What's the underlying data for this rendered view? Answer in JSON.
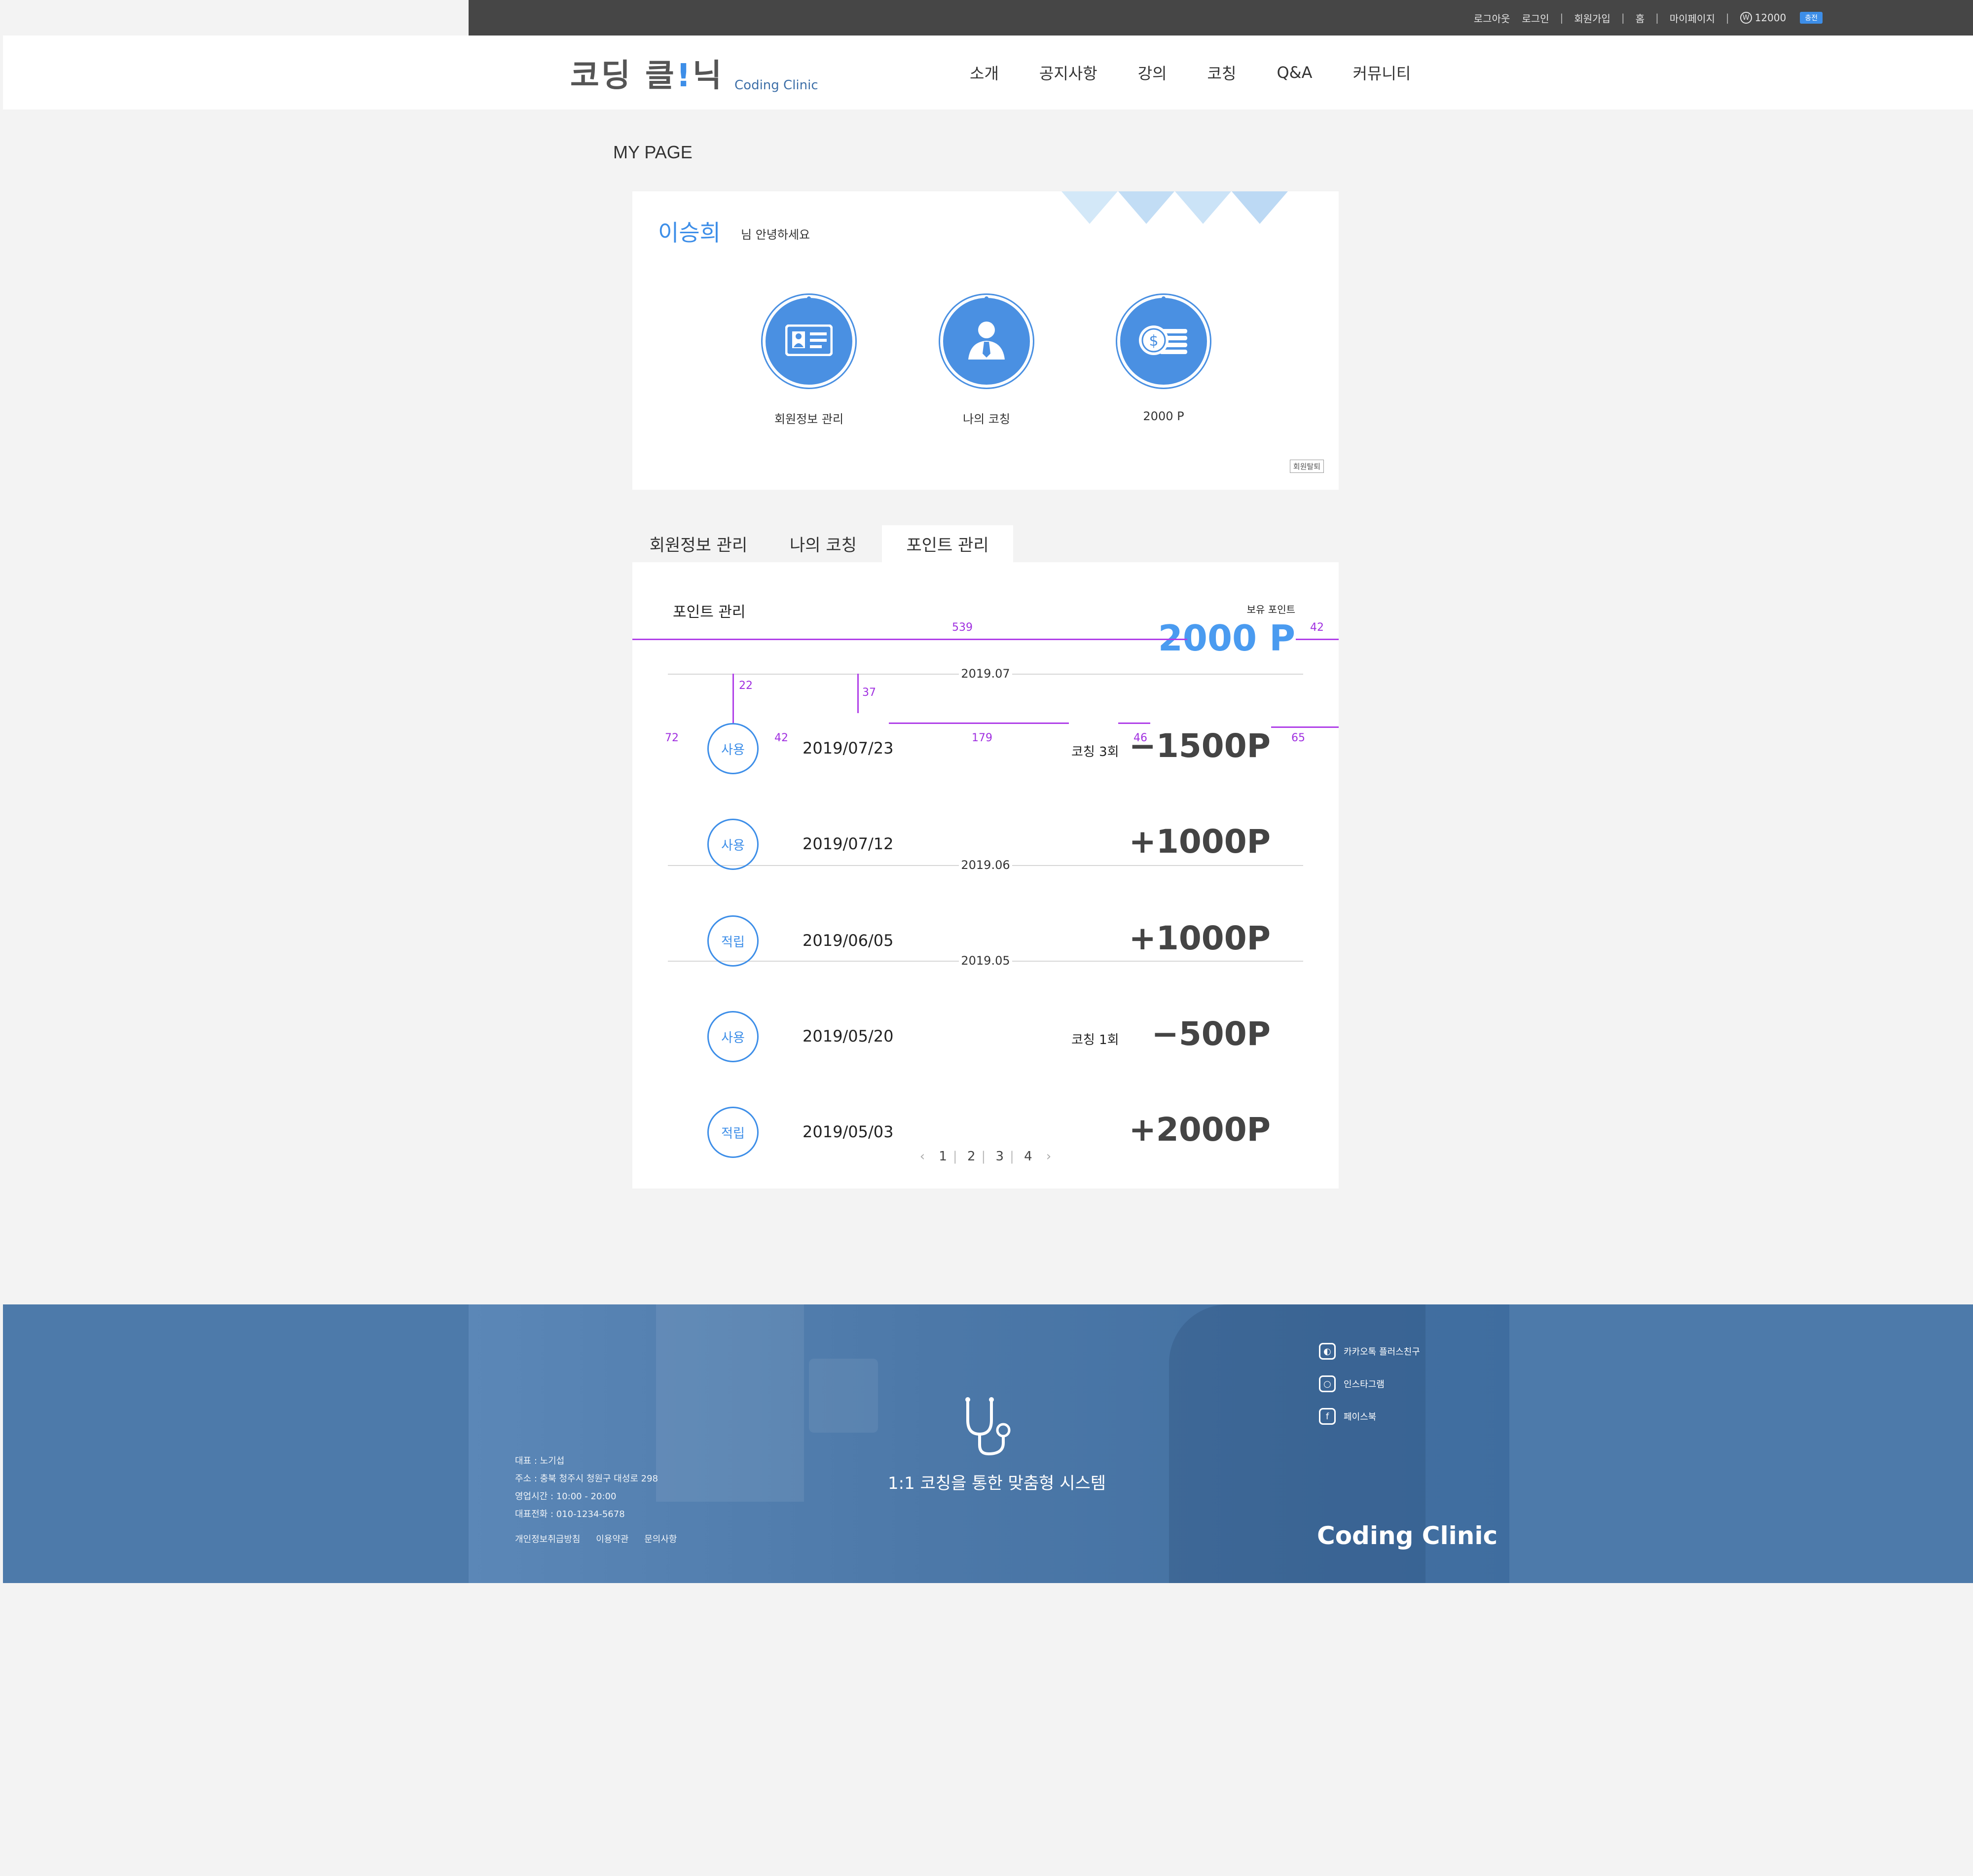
{
  "topbar": {
    "links": [
      "로그아웃",
      "로그인",
      "회원가입",
      "홈",
      "마이페이지"
    ],
    "points": "12000",
    "charge": "충전",
    "won_icon": "W"
  },
  "header": {
    "logo_kr_1": "코딩",
    "logo_kr_2": "클",
    "logo_kr_dot": "!",
    "logo_kr_3": "닉",
    "logo_en": "Coding Clinic",
    "nav": [
      "소개",
      "공지사항",
      "강의",
      "코칭",
      "Q&A",
      "커뮤니티"
    ]
  },
  "mypage": {
    "title": "MY PAGE",
    "user_name": "이승희",
    "greeting": "님 안녕하세요",
    "menus": [
      {
        "label": "회원정보 관리",
        "icon": "id-card-icon"
      },
      {
        "label": "나의 코칭",
        "icon": "person-tie-icon"
      },
      {
        "label": "2000 P",
        "icon": "coins-icon"
      }
    ],
    "withdraw": "회원탈퇴"
  },
  "tabs": [
    "회원정보 관리",
    "나의 코칭",
    "포인트 관리"
  ],
  "points": {
    "title": "포인트 관리",
    "own_label": "보유 포인트",
    "own_value": "2000 P",
    "months": [
      "2019.07",
      "2019.06",
      "2019.05"
    ],
    "transactions": [
      {
        "type": "사용",
        "date": "2019/07/23",
        "memo": "코칭 3회",
        "amount": "−1500P"
      },
      {
        "type": "사용",
        "date": "2019/07/12",
        "memo": "",
        "amount": "+1000P"
      },
      {
        "type": "적립",
        "date": "2019/06/05",
        "memo": "",
        "amount": "+1000P"
      },
      {
        "type": "사용",
        "date": "2019/05/20",
        "memo": "코칭 1회",
        "amount": "−500P"
      },
      {
        "type": "적립",
        "date": "2019/05/03",
        "memo": "",
        "amount": "+2000P"
      }
    ],
    "pages": [
      "1",
      "2",
      "3",
      "4"
    ],
    "prev": "‹",
    "next": "›"
  },
  "redlines": {
    "w539": "539",
    "w42a": "42",
    "h22": "22",
    "h37": "37",
    "w72": "72",
    "w42b": "42",
    "w179": "179",
    "w46": "46",
    "w65": "65"
  },
  "footer": {
    "info": [
      "대표 : 노기섭",
      "주소 : 충북 청주시 청원구 대성로 298",
      "영업시간 : 10:00 - 20:00",
      "대표전화 : 010-1234-5678"
    ],
    "links": [
      "개인정보취급방침",
      "이용약관",
      "문의사항"
    ],
    "slogan": "1:1 코칭을 통한 맞춤형 시스템",
    "social": [
      {
        "label": "카카오톡 플러스친구",
        "icon": "kakao-icon"
      },
      {
        "label": "인스타그램",
        "icon": "instagram-icon"
      },
      {
        "label": "페이스북",
        "icon": "facebook-icon"
      }
    ],
    "brand": "Coding Clinic"
  },
  "colors": {
    "accent": "#3d8ee8",
    "topbar": "#464646",
    "footer": "#4d7aaa",
    "redline": "#b040e8"
  }
}
